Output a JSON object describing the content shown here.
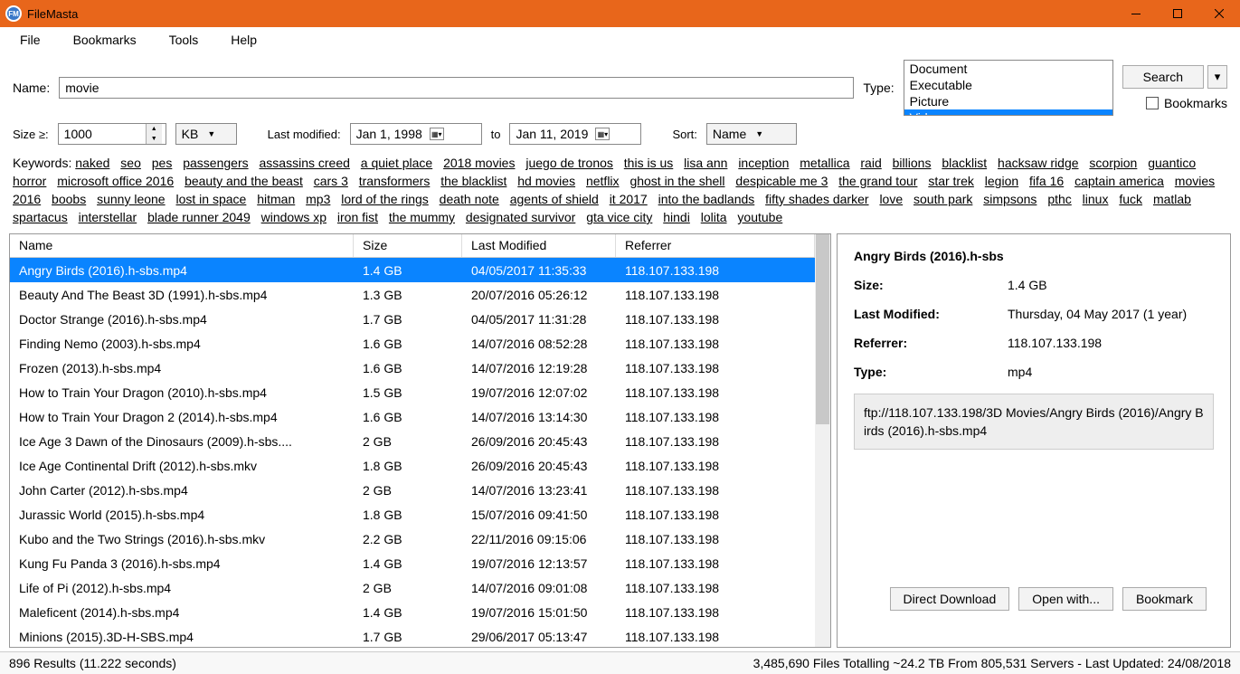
{
  "window": {
    "title": "FileMasta",
    "logo_text": "FM"
  },
  "menu": {
    "file": "File",
    "bookmarks": "Bookmarks",
    "tools": "Tools",
    "help": "Help"
  },
  "search": {
    "name_label": "Name:",
    "name_value": "movie",
    "type_label": "Type:",
    "types": [
      "Document",
      "Executable",
      "Picture",
      "Video"
    ],
    "type_selected": "Video",
    "search_btn": "Search",
    "bookmarks_chk": "Bookmarks",
    "size_label": "Size ≥:",
    "size_value": "1000",
    "size_unit": "KB",
    "lastmod_label": "Last modified:",
    "date_from": "Jan  1, 1998",
    "to_label": "to",
    "date_to": "Jan 11, 2019",
    "sort_label": "Sort:",
    "sort_value": "Name"
  },
  "keywords_label": "Keywords:",
  "keywords": [
    "naked",
    "seo",
    "pes",
    "passengers",
    "assassins creed",
    "a quiet place",
    "2018 movies",
    "juego de tronos",
    "this is us",
    "lisa ann",
    "inception",
    "metallica",
    "raid",
    "billions",
    "blacklist",
    "hacksaw ridge",
    "scorpion",
    "guantico",
    "horror",
    "microsoft office 2016",
    "beauty and the beast",
    "cars 3",
    "transformers",
    "the blacklist",
    "hd movies",
    "netflix",
    "ghost in the shell",
    "despicable me 3",
    "the grand tour",
    "star trek",
    "legion",
    "fifa 16",
    "captain america",
    "movies 2016",
    "boobs",
    "sunny leone",
    "lost in space",
    "hitman",
    "mp3",
    "lord of the rings",
    "death note",
    "agents of shield",
    "it 2017",
    "into the badlands",
    "fifty shades darker",
    "love",
    "south park",
    "simpsons",
    "pthc",
    "linux",
    "fuck",
    "matlab",
    "spartacus",
    "interstellar",
    "blade runner 2049",
    "windows xp",
    "iron fist",
    "the mummy",
    "designated survivor",
    "gta vice city",
    "hindi",
    "lolita",
    "youtube"
  ],
  "columns": {
    "name": "Name",
    "size": "Size",
    "mod": "Last Modified",
    "ref": "Referrer"
  },
  "rows": [
    {
      "name": "Angry Birds (2016).h-sbs.mp4",
      "size": "1.4 GB",
      "mod": "04/05/2017 11:35:33",
      "ref": "118.107.133.198",
      "sel": true
    },
    {
      "name": "Beauty And The Beast 3D (1991).h-sbs.mp4",
      "size": "1.3 GB",
      "mod": "20/07/2016 05:26:12",
      "ref": "118.107.133.198"
    },
    {
      "name": "Doctor Strange (2016).h-sbs.mp4",
      "size": "1.7 GB",
      "mod": "04/05/2017 11:31:28",
      "ref": "118.107.133.198"
    },
    {
      "name": "Finding Nemo (2003).h-sbs.mp4",
      "size": "1.6 GB",
      "mod": "14/07/2016 08:52:28",
      "ref": "118.107.133.198"
    },
    {
      "name": "Frozen (2013).h-sbs.mp4",
      "size": "1.6 GB",
      "mod": "14/07/2016 12:19:28",
      "ref": "118.107.133.198"
    },
    {
      "name": "How to Train Your Dragon (2010).h-sbs.mp4",
      "size": "1.5 GB",
      "mod": "19/07/2016 12:07:02",
      "ref": "118.107.133.198"
    },
    {
      "name": "How to Train Your Dragon 2 (2014).h-sbs.mp4",
      "size": "1.6 GB",
      "mod": "14/07/2016 13:14:30",
      "ref": "118.107.133.198"
    },
    {
      "name": "Ice Age 3 Dawn of the Dinosaurs (2009).h-sbs....",
      "size": "2 GB",
      "mod": "26/09/2016 20:45:43",
      "ref": "118.107.133.198"
    },
    {
      "name": "Ice Age Continental Drift (2012).h-sbs.mkv",
      "size": "1.8 GB",
      "mod": "26/09/2016 20:45:43",
      "ref": "118.107.133.198"
    },
    {
      "name": "John Carter (2012).h-sbs.mp4",
      "size": "2 GB",
      "mod": "14/07/2016 13:23:41",
      "ref": "118.107.133.198"
    },
    {
      "name": "Jurassic World (2015).h-sbs.mp4",
      "size": "1.8 GB",
      "mod": "15/07/2016 09:41:50",
      "ref": "118.107.133.198"
    },
    {
      "name": "Kubo and the Two Strings (2016).h-sbs.mkv",
      "size": "2.2 GB",
      "mod": "22/11/2016 09:15:06",
      "ref": "118.107.133.198"
    },
    {
      "name": "Kung Fu Panda 3 (2016).h-sbs.mp4",
      "size": "1.4 GB",
      "mod": "19/07/2016 12:13:57",
      "ref": "118.107.133.198"
    },
    {
      "name": "Life of Pi (2012).h-sbs.mp4",
      "size": "2 GB",
      "mod": "14/07/2016 09:01:08",
      "ref": "118.107.133.198"
    },
    {
      "name": "Maleficent (2014).h-sbs.mp4",
      "size": "1.4 GB",
      "mod": "19/07/2016 15:01:50",
      "ref": "118.107.133.198"
    },
    {
      "name": "Minions (2015).3D-H-SBS.mp4",
      "size": "1.7 GB",
      "mod": "29/06/2017 05:13:47",
      "ref": "118.107.133.198"
    }
  ],
  "details": {
    "title": "Angry Birds (2016).h-sbs",
    "size_label": "Size:",
    "size_val": "1.4 GB",
    "mod_label": "Last Modified:",
    "mod_val": "Thursday, 04 May 2017 (1 year)",
    "ref_label": "Referrer:",
    "ref_val": "118.107.133.198",
    "type_label": "Type:",
    "type_val": "mp4",
    "url": "ftp://118.107.133.198/3D Movies/Angry Birds (2016)/Angry Birds (2016).h-sbs.mp4",
    "btn_download": "Direct Download",
    "btn_open": "Open with...",
    "btn_bookmark": "Bookmark"
  },
  "status": {
    "left": "896 Results (11.222 seconds)",
    "right": "3,485,690 Files Totalling ~24.2 TB From 805,531 Servers - Last Updated: 24/08/2018"
  }
}
